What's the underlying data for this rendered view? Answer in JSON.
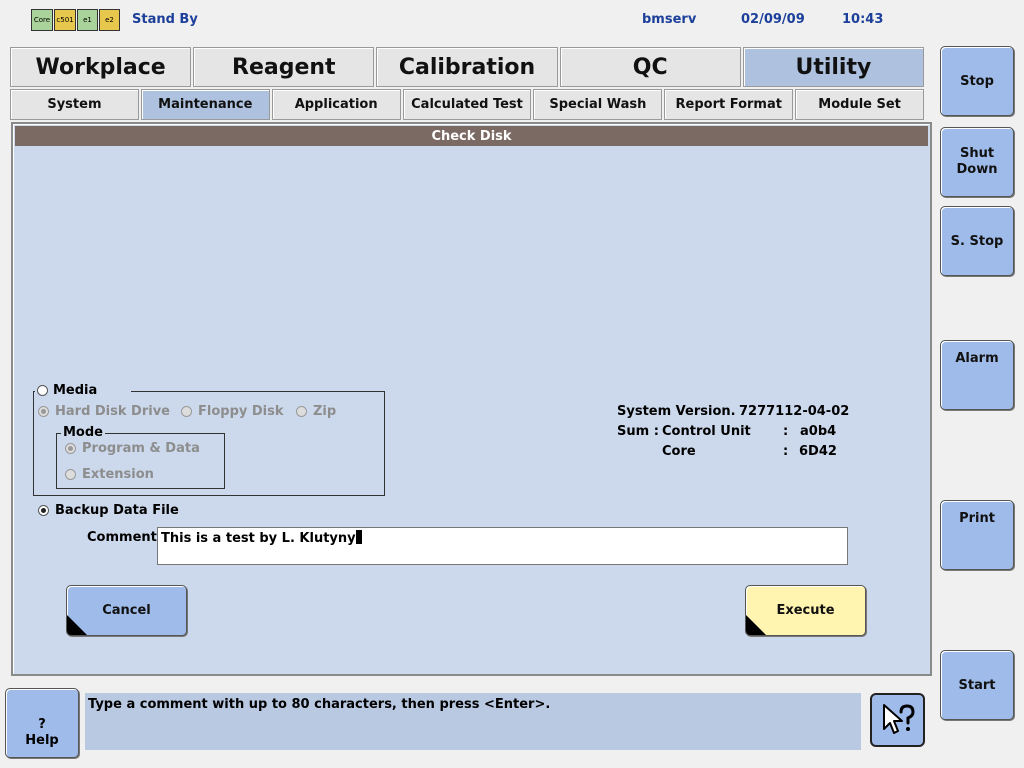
{
  "header": {
    "modules": [
      {
        "label": "Core",
        "color": "#a9d39a"
      },
      {
        "label": "c501",
        "color": "#e7c84d"
      },
      {
        "label": "e1",
        "color": "#a9d39a"
      },
      {
        "label": "e2",
        "color": "#e7c84d"
      }
    ],
    "status": "Stand By",
    "user": "bmserv",
    "date": "02/09/09",
    "time": "10:43"
  },
  "main_tabs": [
    "Workplace",
    "Reagent",
    "Calibration",
    "QC",
    "Utility"
  ],
  "sub_tabs": [
    "System",
    "Maintenance",
    "Application",
    "Calculated Test",
    "Special Wash",
    "Report Format",
    "Module Set"
  ],
  "panel": {
    "title": "Check Disk",
    "media_label": "Media",
    "media_options": [
      "Hard Disk Drive",
      "Floppy Disk",
      "Zip"
    ],
    "mode_label": "Mode",
    "mode_options": [
      "Program & Data",
      "Extension"
    ],
    "backup_label": "Backup Data File",
    "comment_label": "Comment",
    "comment_value": "This is a test by L. Klutyny",
    "system_version_label": "System Version.",
    "system_version_value": "7277112-04-02",
    "sum_label": "Sum :",
    "control_unit_label": "Control Unit",
    "control_unit_value": "a0b4",
    "core_label": "Core",
    "core_value": "6D42",
    "separator": ":",
    "cancel_label": "Cancel",
    "execute_label": "Execute"
  },
  "side_buttons": {
    "stop": "Stop",
    "shutdown_line1": "Shut",
    "shutdown_line2": "Down",
    "sstop": "S. Stop",
    "alarm": "Alarm",
    "print": "Print",
    "start": "Start"
  },
  "footer": {
    "help_q": "?",
    "help_label": "Help",
    "message": "Type a comment with up to 80 characters, then press <Enter>."
  },
  "colors": {
    "panel_bg": "#ccd9ec",
    "title_bar": "#7b6a64",
    "active_tab": "#aec2e0",
    "button_blue": "#9fbbe9",
    "button_yellow": "#fff4b0",
    "header_text": "#1c3f9a"
  }
}
